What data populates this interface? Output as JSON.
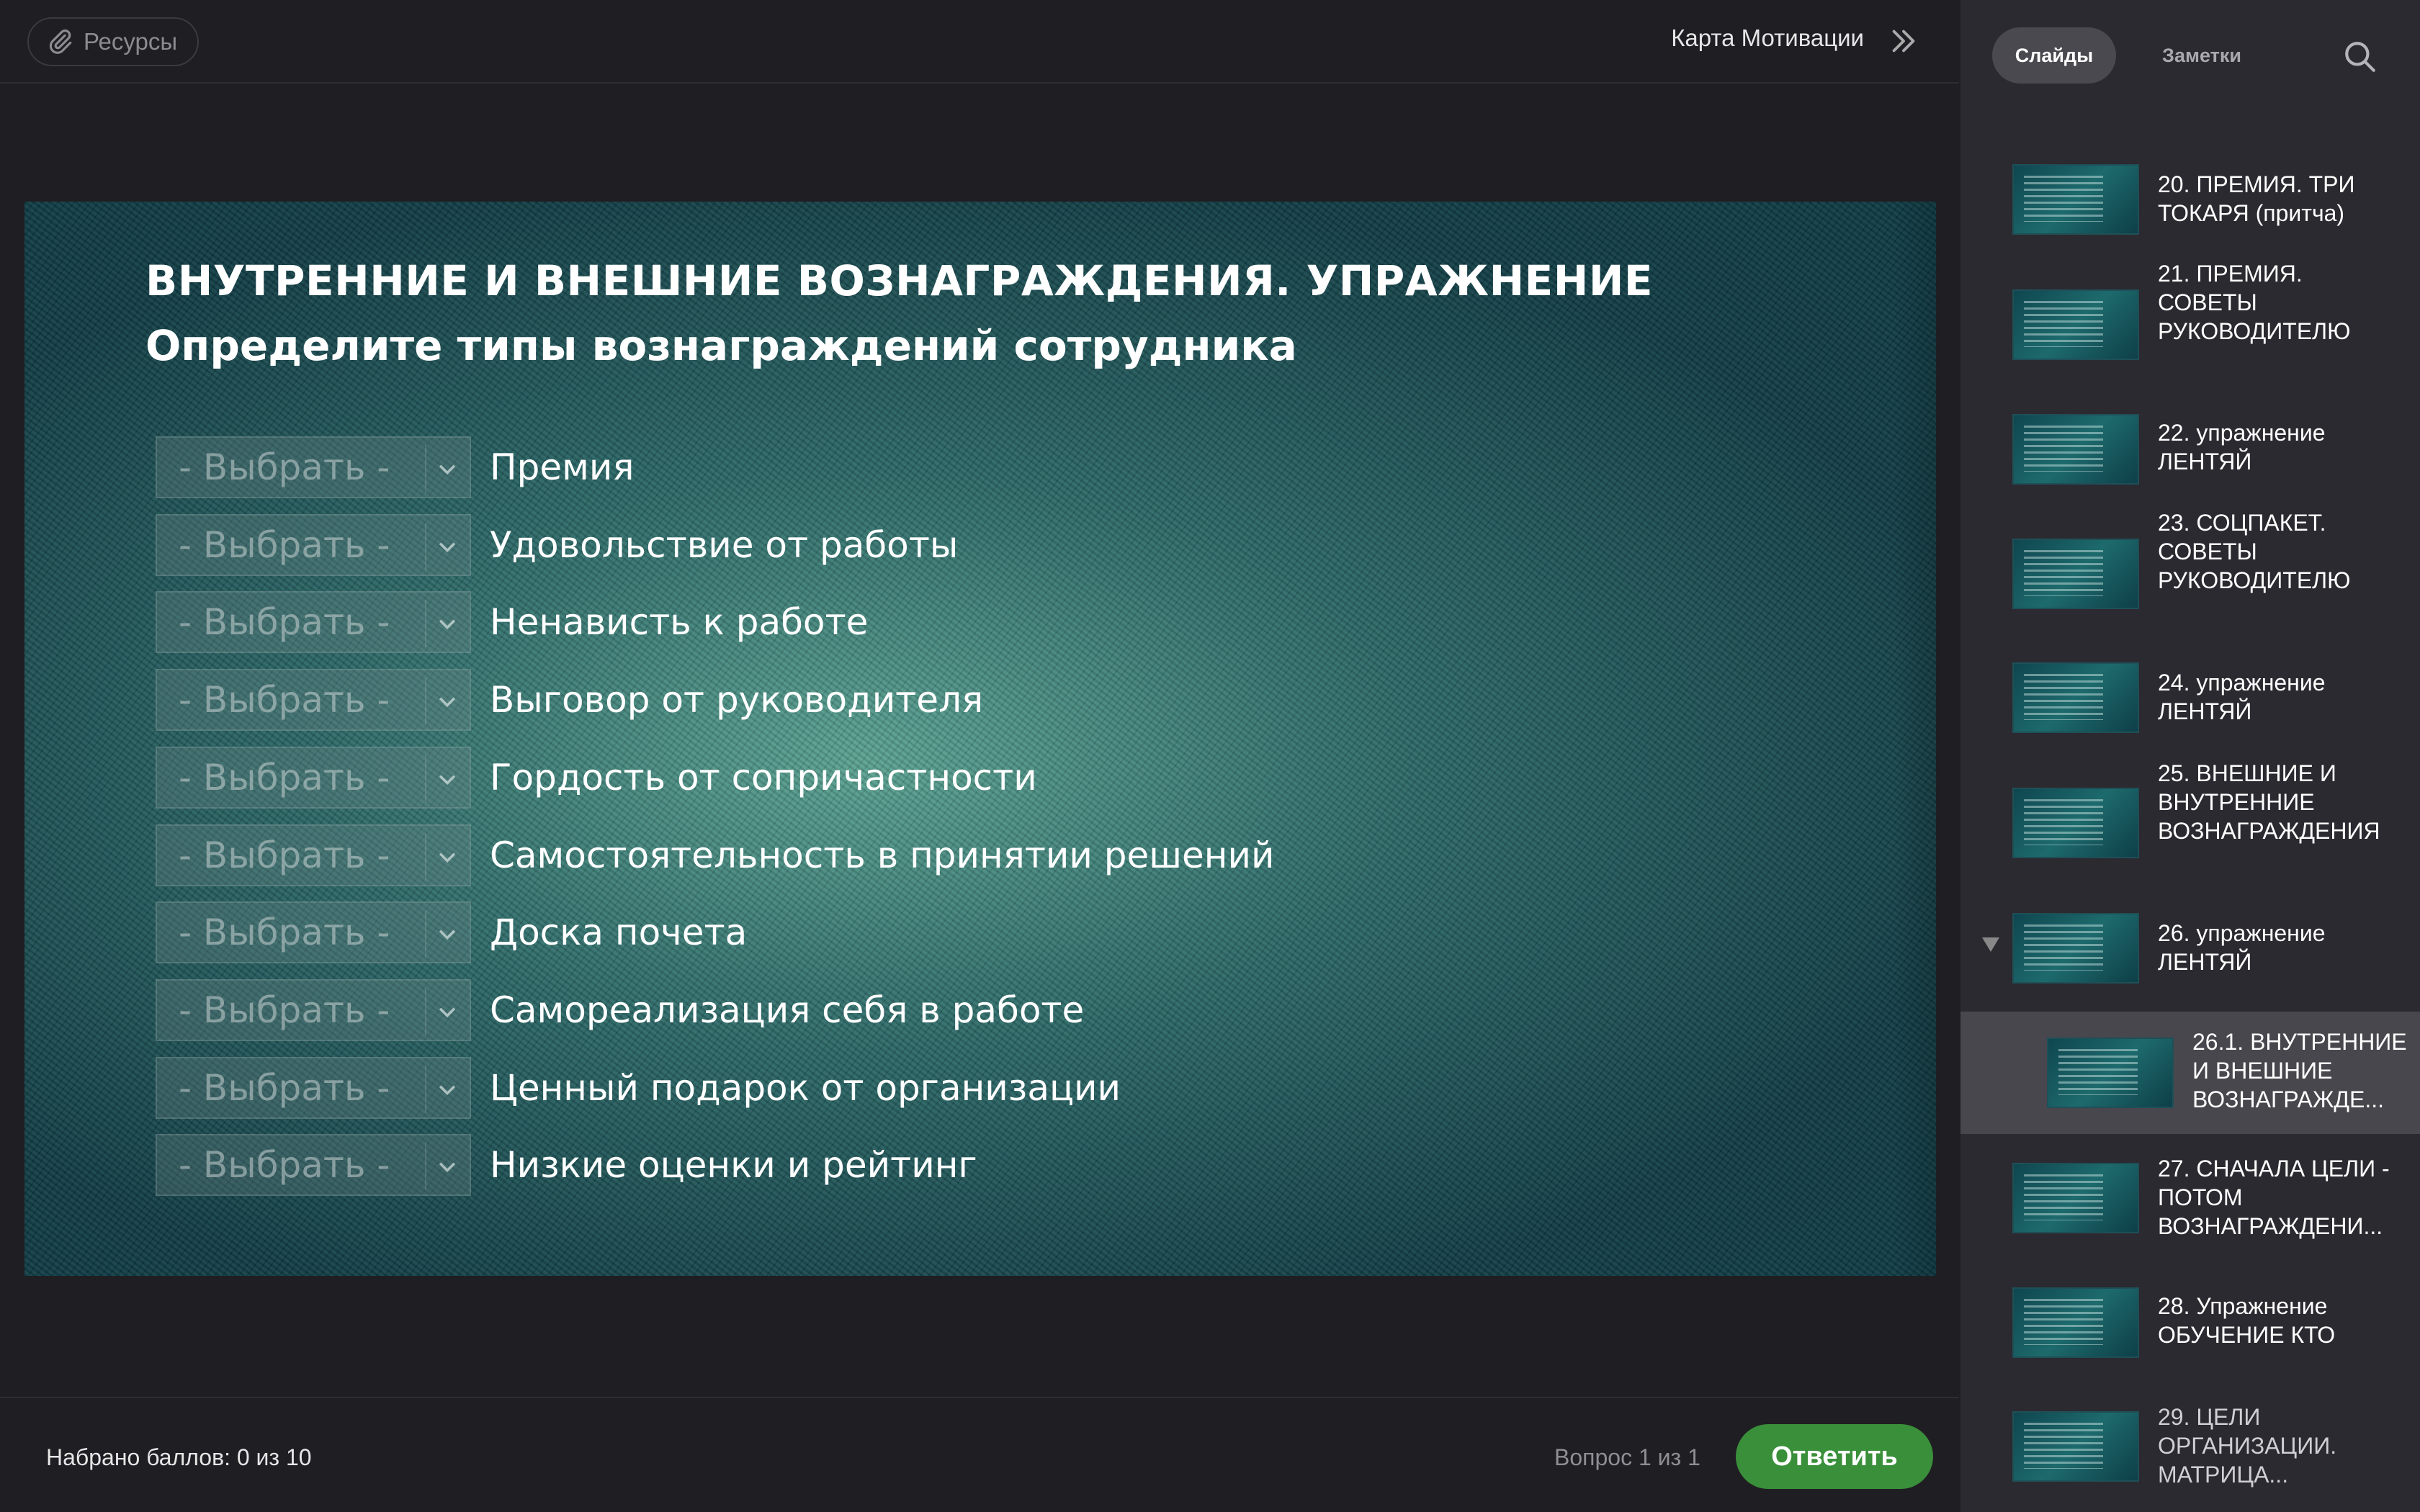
{
  "topbar": {
    "resources_label": "Ресурсы",
    "course_title": "Карта Мотивации"
  },
  "slide": {
    "title": "ВНУТРЕННИЕ И ВНЕШНИЕ ВОЗНАГРАЖДЕНИЯ. УПРАЖНЕНИЕ",
    "subtitle": "Определите типы вознаграждений сотрудника",
    "dropdown_placeholder": "- Выбрать -",
    "items": [
      "Премия",
      "Удовольствие от работы",
      "Ненависть к работе",
      "Выговор от руководителя",
      "Гордость от сопричастности",
      "Самостоятельность в принятии решений",
      "Доска почета",
      "Самореализация себя в работе",
      "Ценный подарок от организации",
      "Низкие оценки и рейтинг"
    ]
  },
  "bottombar": {
    "score": "Набрано баллов: 0 из 10",
    "question_count": "Вопрос 1 из 1",
    "answer_label": "Ответить"
  },
  "sidebar": {
    "tab_slides": "Слайды",
    "tab_notes": "Заметки",
    "slides": [
      "20. ПРЕМИЯ. ТРИ ТОКАРЯ (притча)",
      "21. ПРЕМИЯ. СОВЕТЫ РУКОВОДИТЕЛЮ",
      "22. упражнение ЛЕНТЯЙ",
      "23. СОЦПАКЕТ. СОВЕТЫ РУКОВОДИТЕЛЮ",
      "24. упражнение ЛЕНТЯЙ",
      "25. ВНЕШНИЕ И ВНУТРЕННИЕ ВОЗНАГРАЖДЕНИЯ",
      "26. упражнение ЛЕНТЯЙ",
      "26.1. ВНУТРЕННИЕ И ВНЕШНИЕ ВОЗНАГРАЖДЕ...",
      "27. СНАЧАЛА ЦЕЛИ - ПОТОМ ВОЗНАГРАЖДЕНИ...",
      "28. Упражнение ОБУЧЕНИЕ КТО",
      "29. ЦЕЛИ ОРГАНИЗАЦИИ. МАТРИЦА..."
    ]
  }
}
